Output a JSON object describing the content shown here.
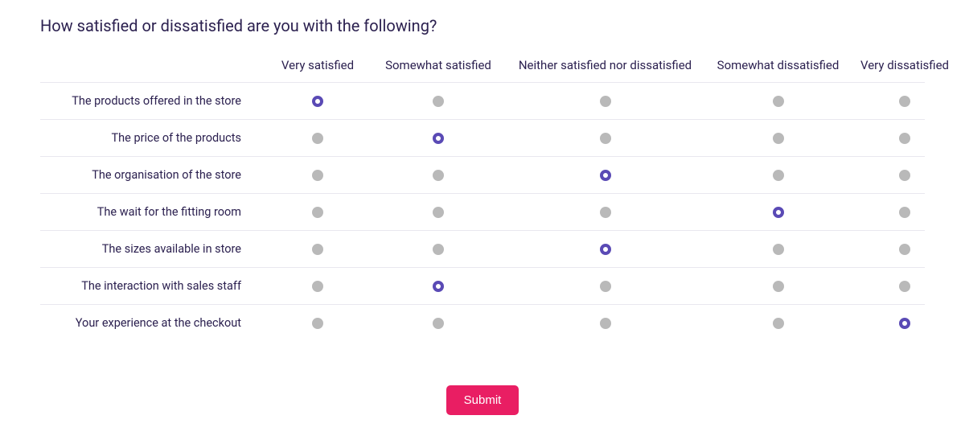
{
  "question": "How satisfied or dissatisfied are you with the following?",
  "columns": [
    "Very satisfied",
    "Somewhat satisfied",
    "Neither satisfied nor dissatisfied",
    "Somewhat dissatisfied",
    "Very dissatisfied"
  ],
  "rows": [
    {
      "label": "The products offered in the store",
      "selected": 0
    },
    {
      "label": "The price of the products",
      "selected": 1
    },
    {
      "label": "The organisation of the store",
      "selected": 2
    },
    {
      "label": "The wait for the fitting room",
      "selected": 3
    },
    {
      "label": "The sizes available in store",
      "selected": 2
    },
    {
      "label": "The interaction with sales staff",
      "selected": 1
    },
    {
      "label": "Your experience at the checkout",
      "selected": 4
    }
  ],
  "submit_label": "Submit"
}
